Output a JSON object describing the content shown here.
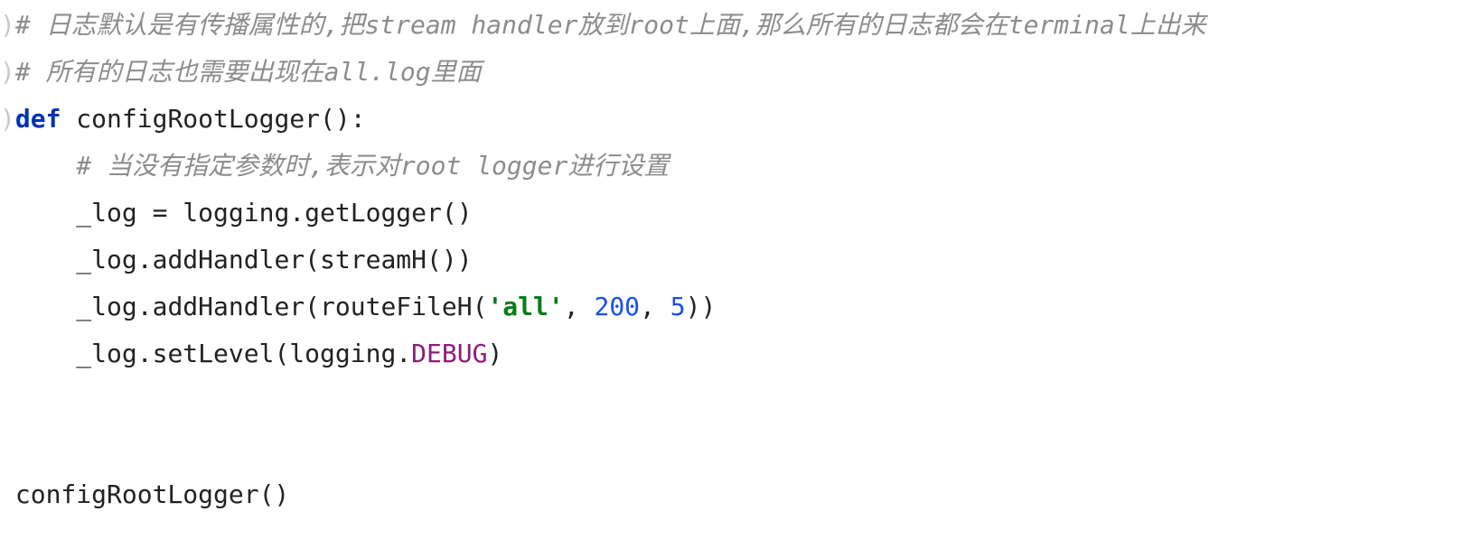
{
  "code": {
    "line1": {
      "comment_full": "# 日志默认是有传播属性的,把stream handler放到root上面,那么所有的日志都会在terminal上出来"
    },
    "line2": {
      "comment_full": "# 所有的日志也需要出现在all.log里面"
    },
    "line3": {
      "kw_def": "def",
      "fn_name": " configRootLogger():"
    },
    "line4": {
      "comment_full": "# 当没有指定参数时,表示对root logger进行设置"
    },
    "line5": {
      "text": "_log = logging.getLogger()"
    },
    "line6": {
      "pre": "_log.addHandler(streamH())"
    },
    "line7": {
      "a": "_log.addHandler(routeFileH(",
      "str": "'all'",
      "b": ", ",
      "n1": "200",
      "c": ", ",
      "n2": "5",
      "d": "))"
    },
    "line8": {
      "a": "_log.setLevel(logging.",
      "member": "DEBUG",
      "b": ")"
    },
    "line11": {
      "text": "configRootLogger()"
    }
  }
}
